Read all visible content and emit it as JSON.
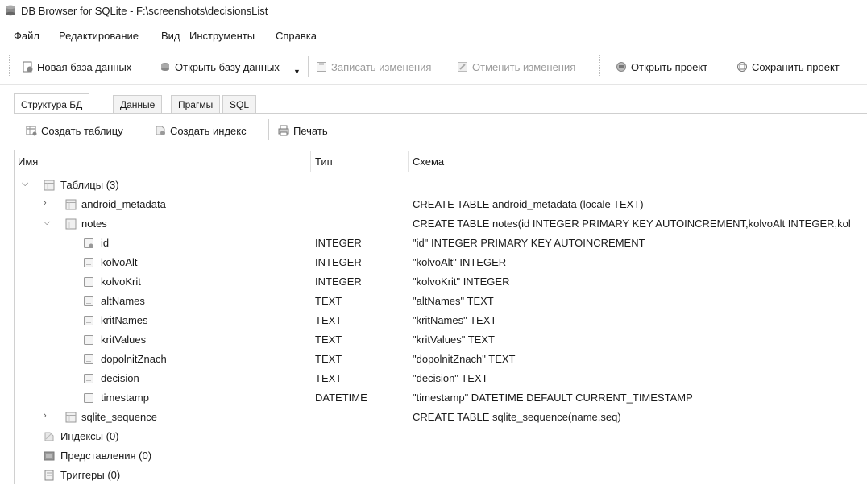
{
  "window": {
    "title": "DB Browser for SQLite - F:\\screenshots\\decisionsList"
  },
  "menu": [
    "Файл",
    "Редактирование",
    "Вид",
    "Инструменты",
    "Справка"
  ],
  "toolbar": {
    "new_db": "Новая база данных",
    "open_db": "Открыть базу данных",
    "write_changes": "Записать изменения",
    "revert_changes": "Отменить изменения",
    "open_project": "Открыть проект",
    "save_project": "Сохранить проект"
  },
  "tabs": [
    "Структура БД",
    "Данные",
    "Прагмы",
    "SQL"
  ],
  "subtoolbar": {
    "create_table": "Создать таблицу",
    "create_index": "Создать индекс",
    "print": "Печать"
  },
  "tree": {
    "headers": {
      "name": "Имя",
      "type": "Тип",
      "schema": "Схема"
    },
    "tables_label": "Таблицы (3)",
    "android_metadata": {
      "name": "android_metadata",
      "schema": "CREATE TABLE android_metadata (locale TEXT)"
    },
    "notes": {
      "name": "notes",
      "schema": "CREATE TABLE notes(id INTEGER PRIMARY KEY AUTOINCREMENT,kolvoAlt INTEGER,kol"
    },
    "fields": [
      {
        "name": "id",
        "type": "INTEGER",
        "schema": "\"id\" INTEGER PRIMARY KEY AUTOINCREMENT"
      },
      {
        "name": "kolvoAlt",
        "type": "INTEGER",
        "schema": "\"kolvoAlt\" INTEGER"
      },
      {
        "name": "kolvoKrit",
        "type": "INTEGER",
        "schema": "\"kolvoKrit\" INTEGER"
      },
      {
        "name": "altNames",
        "type": "TEXT",
        "schema": "\"altNames\" TEXT"
      },
      {
        "name": "kritNames",
        "type": "TEXT",
        "schema": "\"kritNames\" TEXT"
      },
      {
        "name": "kritValues",
        "type": "TEXT",
        "schema": "\"kritValues\" TEXT"
      },
      {
        "name": "dopolnitZnach",
        "type": "TEXT",
        "schema": "\"dopolnitZnach\" TEXT"
      },
      {
        "name": "decision",
        "type": "TEXT",
        "schema": "\"decision\" TEXT"
      },
      {
        "name": "timestamp",
        "type": "DATETIME",
        "schema": "\"timestamp\" DATETIME DEFAULT CURRENT_TIMESTAMP"
      }
    ],
    "sqlite_sequence": {
      "name": "sqlite_sequence",
      "schema": "CREATE TABLE sqlite_sequence(name,seq)"
    },
    "indexes_label": "Индексы (0)",
    "views_label": "Представления (0)",
    "triggers_label": "Триггеры (0)"
  }
}
